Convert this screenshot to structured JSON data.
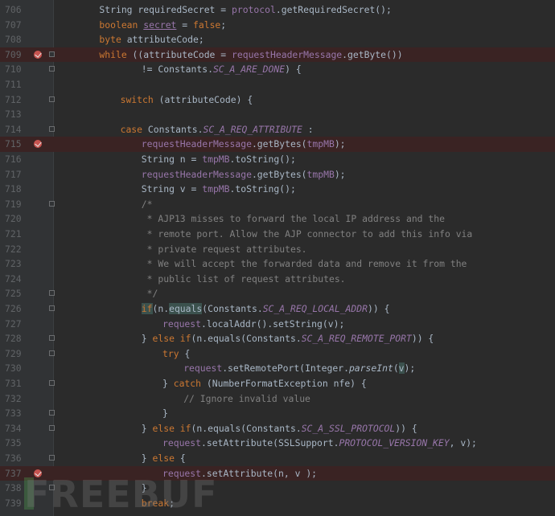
{
  "editor": {
    "lines": [
      {
        "num": "706",
        "bp": false,
        "fold": false,
        "indent": 4,
        "tokens": [
          [
            "String requiredSecret = ",
            "plain"
          ],
          [
            "protocol",
            "field"
          ],
          [
            ".getRequiredSecret();",
            "plain"
          ]
        ]
      },
      {
        "num": "707",
        "bp": false,
        "fold": false,
        "indent": 4,
        "tokens": [
          [
            "boolean ",
            "kw"
          ],
          [
            "secret",
            "field-u"
          ],
          [
            " = ",
            "plain"
          ],
          [
            "false",
            "kw"
          ],
          [
            ";",
            "plain"
          ]
        ]
      },
      {
        "num": "708",
        "bp": false,
        "fold": false,
        "indent": 4,
        "tokens": [
          [
            "byte ",
            "kw"
          ],
          [
            "attributeCode;",
            "plain"
          ]
        ]
      },
      {
        "num": "709",
        "bp": true,
        "fold": true,
        "indent": 4,
        "tokens": [
          [
            "while ",
            "kw"
          ],
          [
            "((attributeCode = ",
            "plain"
          ],
          [
            "requestHeaderMessage",
            "field"
          ],
          [
            ".getByte())",
            "plain"
          ]
        ]
      },
      {
        "num": "710",
        "bp": false,
        "fold": true,
        "indent": 8,
        "tokens": [
          [
            "!= Constants.",
            "plain"
          ],
          [
            "SC_A_ARE_DONE",
            "const"
          ],
          [
            ") {",
            "plain"
          ]
        ]
      },
      {
        "num": "711",
        "bp": false,
        "fold": false,
        "indent": 0,
        "tokens": []
      },
      {
        "num": "712",
        "bp": false,
        "fold": true,
        "indent": 6,
        "tokens": [
          [
            "switch ",
            "kw"
          ],
          [
            "(attributeCode) {",
            "plain"
          ]
        ]
      },
      {
        "num": "713",
        "bp": false,
        "fold": false,
        "indent": 0,
        "tokens": []
      },
      {
        "num": "714",
        "bp": false,
        "fold": true,
        "indent": 6,
        "tokens": [
          [
            "case ",
            "kw"
          ],
          [
            "Constants.",
            "plain"
          ],
          [
            "SC_A_REQ_ATTRIBUTE",
            "const"
          ],
          [
            " :",
            "plain"
          ]
        ]
      },
      {
        "num": "715",
        "bp": true,
        "fold": false,
        "indent": 8,
        "tokens": [
          [
            "requestHeaderMessage",
            "field"
          ],
          [
            ".getBytes(",
            "plain"
          ],
          [
            "tmpMB",
            "field"
          ],
          [
            ");",
            "plain"
          ]
        ]
      },
      {
        "num": "716",
        "bp": false,
        "fold": false,
        "indent": 8,
        "tokens": [
          [
            "String n = ",
            "plain"
          ],
          [
            "tmpMB",
            "field"
          ],
          [
            ".toString();",
            "plain"
          ]
        ]
      },
      {
        "num": "717",
        "bp": false,
        "fold": false,
        "indent": 8,
        "tokens": [
          [
            "requestHeaderMessage",
            "field"
          ],
          [
            ".getBytes(",
            "plain"
          ],
          [
            "tmpMB",
            "field"
          ],
          [
            ");",
            "plain"
          ]
        ]
      },
      {
        "num": "718",
        "bp": false,
        "fold": false,
        "indent": 8,
        "tokens": [
          [
            "String v = ",
            "plain"
          ],
          [
            "tmpMB",
            "field"
          ],
          [
            ".toString();",
            "plain"
          ]
        ]
      },
      {
        "num": "719",
        "bp": false,
        "fold": true,
        "indent": 8,
        "tokens": [
          [
            "/*",
            "comment"
          ]
        ]
      },
      {
        "num": "720",
        "bp": false,
        "fold": false,
        "indent": 8,
        "tokens": [
          [
            " * AJP13 misses to forward the local IP address and the",
            "comment"
          ]
        ]
      },
      {
        "num": "721",
        "bp": false,
        "fold": false,
        "indent": 8,
        "tokens": [
          [
            " * remote port. Allow the AJP connector to add this info via",
            "comment"
          ]
        ]
      },
      {
        "num": "722",
        "bp": false,
        "fold": false,
        "indent": 8,
        "tokens": [
          [
            " * private request attributes.",
            "comment"
          ]
        ]
      },
      {
        "num": "723",
        "bp": false,
        "fold": false,
        "indent": 8,
        "tokens": [
          [
            " * We will accept the forwarded data and remove it from the",
            "comment"
          ]
        ]
      },
      {
        "num": "724",
        "bp": false,
        "fold": false,
        "indent": 8,
        "tokens": [
          [
            " * public list of request attributes.",
            "comment"
          ]
        ]
      },
      {
        "num": "725",
        "bp": false,
        "fold": true,
        "indent": 8,
        "tokens": [
          [
            " */",
            "comment"
          ]
        ]
      },
      {
        "num": "726",
        "bp": false,
        "fold": true,
        "indent": 8,
        "tokens": [
          [
            "if",
            "kw-hl"
          ],
          [
            "(n.",
            "plain"
          ],
          [
            "equals",
            "plain-hl"
          ],
          [
            "(Constants.",
            "plain"
          ],
          [
            "SC_A_REQ_LOCAL_ADDR",
            "const"
          ],
          [
            ")) {",
            "plain"
          ]
        ]
      },
      {
        "num": "727",
        "bp": false,
        "fold": false,
        "indent": 10,
        "tokens": [
          [
            "request",
            "field"
          ],
          [
            ".localAddr().setString(v);",
            "plain"
          ]
        ]
      },
      {
        "num": "728",
        "bp": false,
        "fold": true,
        "indent": 8,
        "tokens": [
          [
            "} ",
            "plain"
          ],
          [
            "else if",
            "kw"
          ],
          [
            "(n.equals(Constants.",
            "plain"
          ],
          [
            "SC_A_REQ_REMOTE_PORT",
            "const"
          ],
          [
            ")) {",
            "plain"
          ]
        ]
      },
      {
        "num": "729",
        "bp": false,
        "fold": true,
        "indent": 10,
        "tokens": [
          [
            "try ",
            "kw"
          ],
          [
            "{",
            "plain"
          ]
        ]
      },
      {
        "num": "730",
        "bp": false,
        "fold": false,
        "indent": 12,
        "tokens": [
          [
            "request",
            "field"
          ],
          [
            ".setRemotePort(Integer.",
            "plain"
          ],
          [
            "parseInt",
            "meth-i"
          ],
          [
            "(",
            "plain"
          ],
          [
            "v",
            "plain-hl"
          ],
          [
            ");",
            "plain"
          ]
        ]
      },
      {
        "num": "731",
        "bp": false,
        "fold": true,
        "indent": 10,
        "tokens": [
          [
            "} ",
            "plain"
          ],
          [
            "catch ",
            "kw"
          ],
          [
            "(NumberFormatException nfe) {",
            "plain"
          ]
        ]
      },
      {
        "num": "732",
        "bp": false,
        "fold": false,
        "indent": 12,
        "tokens": [
          [
            "// Ignore invalid value",
            "comment"
          ]
        ]
      },
      {
        "num": "733",
        "bp": false,
        "fold": true,
        "indent": 10,
        "tokens": [
          [
            "}",
            "plain"
          ]
        ]
      },
      {
        "num": "734",
        "bp": false,
        "fold": true,
        "indent": 8,
        "tokens": [
          [
            "} ",
            "plain"
          ],
          [
            "else if",
            "kw"
          ],
          [
            "(n.equals(Constants.",
            "plain"
          ],
          [
            "SC_A_SSL_PROTOCOL",
            "const"
          ],
          [
            ")) {",
            "plain"
          ]
        ]
      },
      {
        "num": "735",
        "bp": false,
        "fold": false,
        "indent": 10,
        "tokens": [
          [
            "request",
            "field"
          ],
          [
            ".setAttribute(SSLSupport.",
            "plain"
          ],
          [
            "PROTOCOL_VERSION_KEY",
            "const"
          ],
          [
            ", v);",
            "plain"
          ]
        ]
      },
      {
        "num": "736",
        "bp": false,
        "fold": true,
        "indent": 8,
        "tokens": [
          [
            "} ",
            "plain"
          ],
          [
            "else ",
            "kw"
          ],
          [
            "{",
            "plain"
          ]
        ]
      },
      {
        "num": "737",
        "bp": true,
        "fold": false,
        "indent": 10,
        "tokens": [
          [
            "request",
            "field"
          ],
          [
            ".setAttribute(n, v );",
            "plain"
          ]
        ]
      },
      {
        "num": "738",
        "bp": false,
        "fold": true,
        "indent": 8,
        "tokens": [
          [
            "}",
            "plain"
          ]
        ]
      },
      {
        "num": "739",
        "bp": false,
        "fold": false,
        "indent": 8,
        "tokens": [
          [
            "break",
            "kw"
          ],
          [
            ";",
            "plain"
          ]
        ]
      }
    ]
  },
  "watermark": {
    "text": "FREEBUF"
  }
}
